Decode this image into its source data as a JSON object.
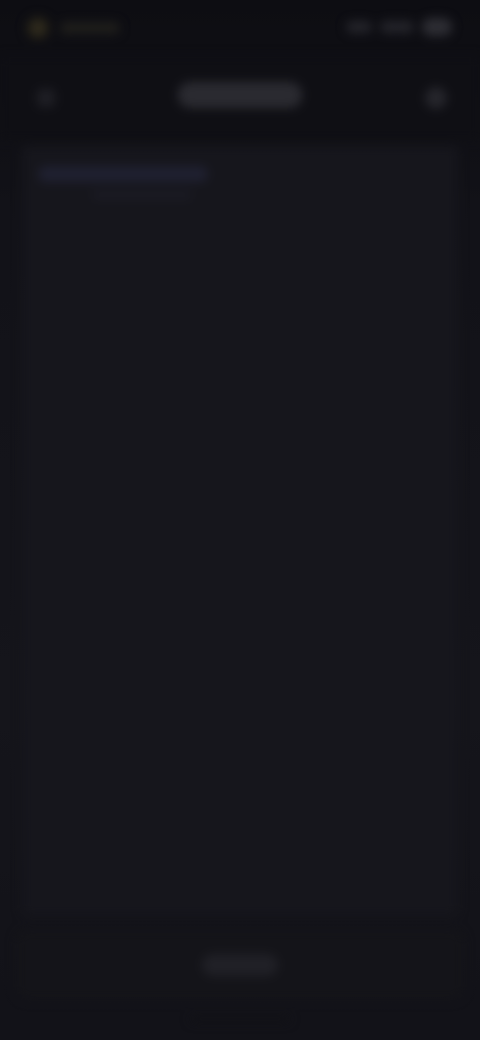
{
  "status_bar": {
    "icons": [
      "app-indicator-icon",
      "signal-icon",
      "wifi-icon",
      "battery-icon"
    ]
  },
  "toolbar": {
    "back_icon": "back-arrow-icon",
    "more_icon": "more-options-icon"
  },
  "colors": {
    "background": "#0b0b0f",
    "surface": "#16161c",
    "toolbar": "#0f0f14"
  }
}
